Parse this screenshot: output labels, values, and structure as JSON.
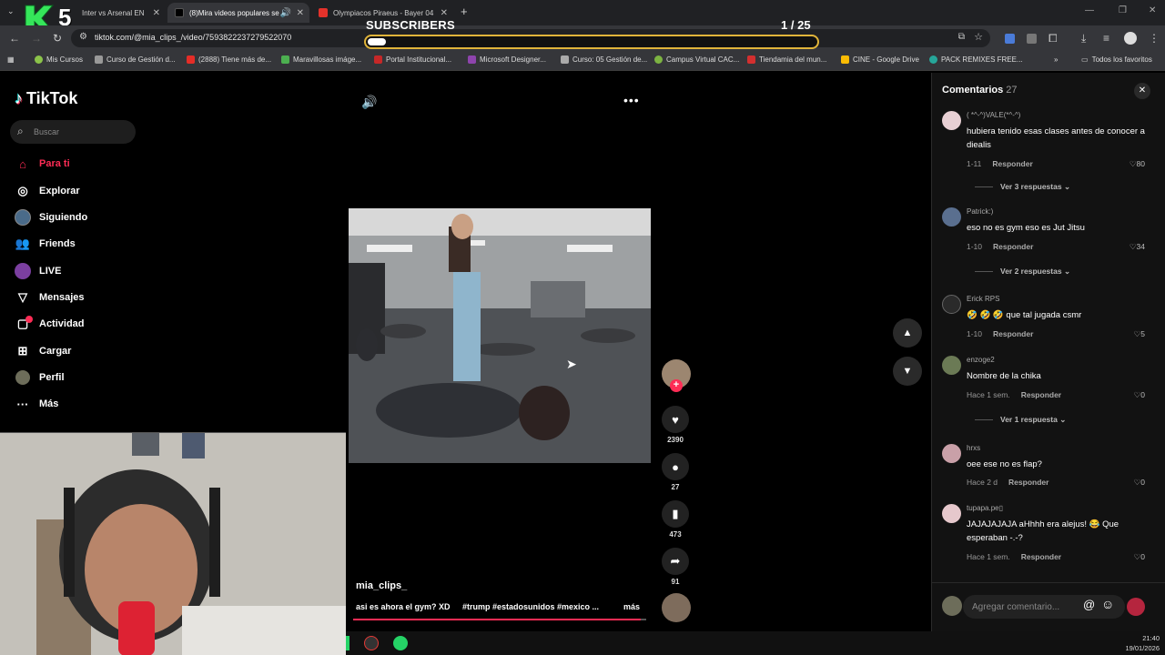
{
  "browser": {
    "tabs": [
      {
        "label": "Inter vs Arsenal EN"
      },
      {
        "label": "(8)Mira videos populares se"
      },
      {
        "label": "Olympiacos Piraeus - Bayer 04"
      }
    ],
    "url": "tiktok.com/@mia_clips_/video/7593822237279522070",
    "bookmarks": [
      "Mis Cursos",
      "Curso de Gestión d...",
      "(2888) Tiene más de...",
      "Maravillosas imáge...",
      "Portal Institucional...",
      "Microsoft Designer...",
      "Curso: 05 Gestión de...",
      "Campus Virtual CAC...",
      "Tiendamia del mun...",
      "CINE - Google Drive",
      "PACK REMIXES FREE..."
    ],
    "all_favorites": "Todos los favoritos",
    "colors": {
      "accent": "#fe2c55",
      "progress": "#e0b43a"
    }
  },
  "overlay": {
    "logo_text": "5",
    "subscribers_label": "SUBSCRIBERS",
    "subscribers_count": "1",
    "subscribers_goal": "/ 25",
    "progress_fraction": 0.04
  },
  "sidebar": {
    "logo": "TikTok",
    "search_placeholder": "Buscar",
    "items": [
      {
        "label": "Para ti",
        "icon": "home-icon"
      },
      {
        "label": "Explorar",
        "icon": "compass-icon"
      },
      {
        "label": "Siguiendo",
        "icon": "following-avatar"
      },
      {
        "label": "Friends",
        "icon": "friends-icon"
      },
      {
        "label": "LIVE",
        "icon": "live-icon"
      },
      {
        "label": "Mensajes",
        "icon": "messages-icon"
      },
      {
        "label": "Actividad",
        "icon": "activity-icon"
      },
      {
        "label": "Cargar",
        "icon": "upload-icon"
      },
      {
        "label": "Perfil",
        "icon": "profile-avatar"
      },
      {
        "label": "Más",
        "icon": "more-icon"
      }
    ]
  },
  "video": {
    "author": "mia_clips_",
    "caption": "asi es ahora el gym? XD",
    "hashtags": "#trump #estadosunidos #mexico ...",
    "more": "más",
    "progress_fraction": 0.98
  },
  "actions": {
    "likes": "2390",
    "comments": "27",
    "saves": "473",
    "shares": "91"
  },
  "comments": {
    "title": "Comentarios",
    "count": "27",
    "reply_label": "Responder",
    "input_placeholder": "Agregar comentario...",
    "items": [
      {
        "user": "( *^-^)VALE(*^-^)",
        "text": "hubiera tenido esas clases antes de conocer a diealis",
        "time": "1-11",
        "likes": "80",
        "more": "Ver 3 respuestas"
      },
      {
        "user": "Patrick:)",
        "text": "eso no es gym eso es Jut Jitsu",
        "time": "1-10",
        "likes": "34",
        "more": "Ver 2 respuestas"
      },
      {
        "user": "Erick RPS",
        "text": "🤣 🤣 🤣 que tal jugada csmr",
        "time": "1-10",
        "likes": "5",
        "more": ""
      },
      {
        "user": "enzoge2",
        "text": "Nombre de la chika",
        "time": "Hace 1 sem.",
        "likes": "0",
        "more": "Ver 1 respuesta"
      },
      {
        "user": "hrxs",
        "text": "oee ese no es flap?",
        "time": "Hace 2 d",
        "likes": "0",
        "more": ""
      },
      {
        "user": "tupapa.pe▯",
        "text": "JAJAJAJAJA aHhhh era alejus! 😂 Que esperaban -.-?",
        "time": "Hace 1 sem.",
        "likes": "0",
        "more": ""
      }
    ]
  },
  "taskbar": {
    "time": "21:40",
    "date": "19/01/2026"
  }
}
